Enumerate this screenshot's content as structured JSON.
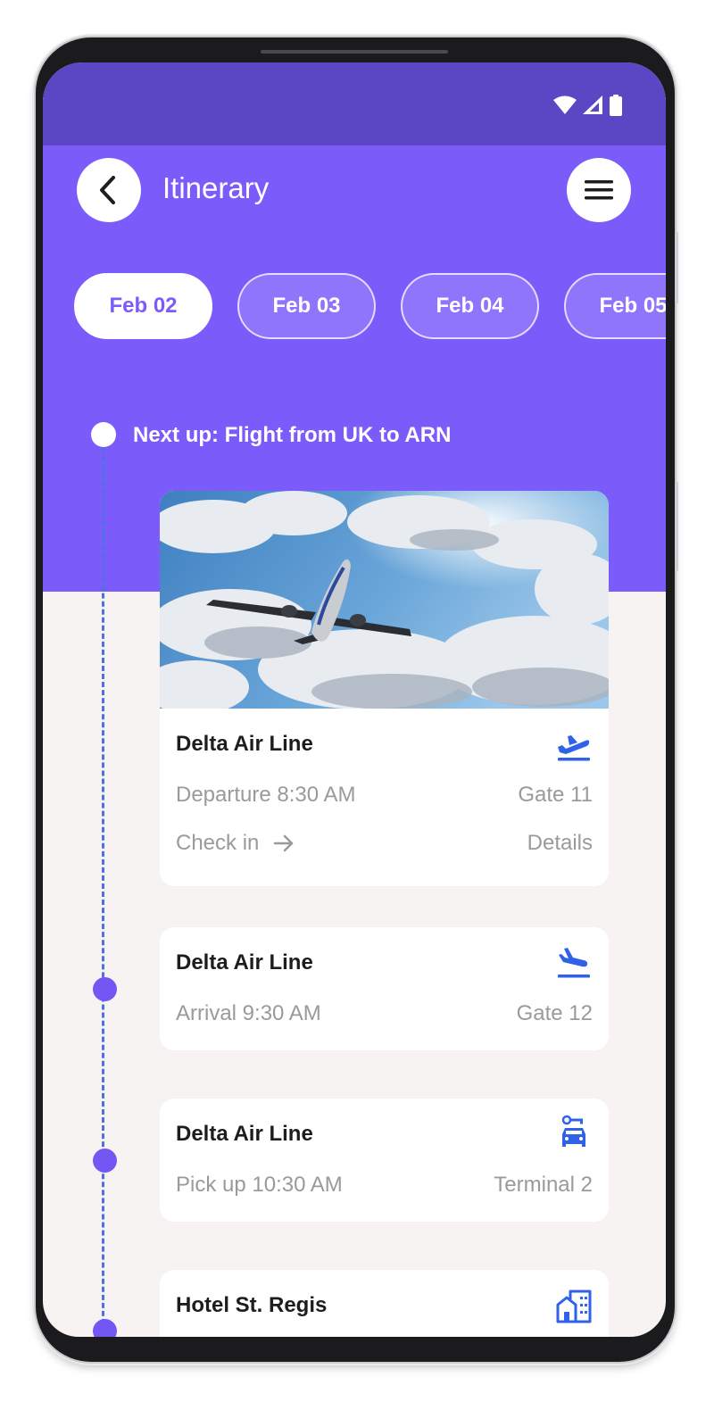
{
  "header": {
    "title": "Itinerary"
  },
  "dates": [
    {
      "label": "Feb 02",
      "active": true
    },
    {
      "label": "Feb 03",
      "active": false
    },
    {
      "label": "Feb 04",
      "active": false
    },
    {
      "label": "Feb 05",
      "active": false
    }
  ],
  "timeline": {
    "next_up": "Next up: Flight from UK to ARN"
  },
  "cards": [
    {
      "title": "Delta Air Line",
      "icon": "flight-takeoff-icon",
      "primary": "Departure 8:30 AM",
      "secondary": "Gate 11",
      "action": "Check in",
      "link": "Details"
    },
    {
      "title": "Delta Air Line",
      "icon": "flight-land-icon",
      "primary": "Arrival 9:30 AM",
      "secondary": "Gate 12"
    },
    {
      "title": "Delta Air Line",
      "icon": "car-rental-icon",
      "primary": "Pick up 10:30 AM",
      "secondary": "Terminal 2"
    },
    {
      "title": "Hotel St. Regis",
      "icon": "hotel-building-icon"
    }
  ],
  "colors": {
    "status_bar": "#5b46c3",
    "header": "#7b5cfa",
    "accent_icon": "#2f62e8",
    "timeline_dot": "#7357f5",
    "background": "#f8f3f3"
  }
}
